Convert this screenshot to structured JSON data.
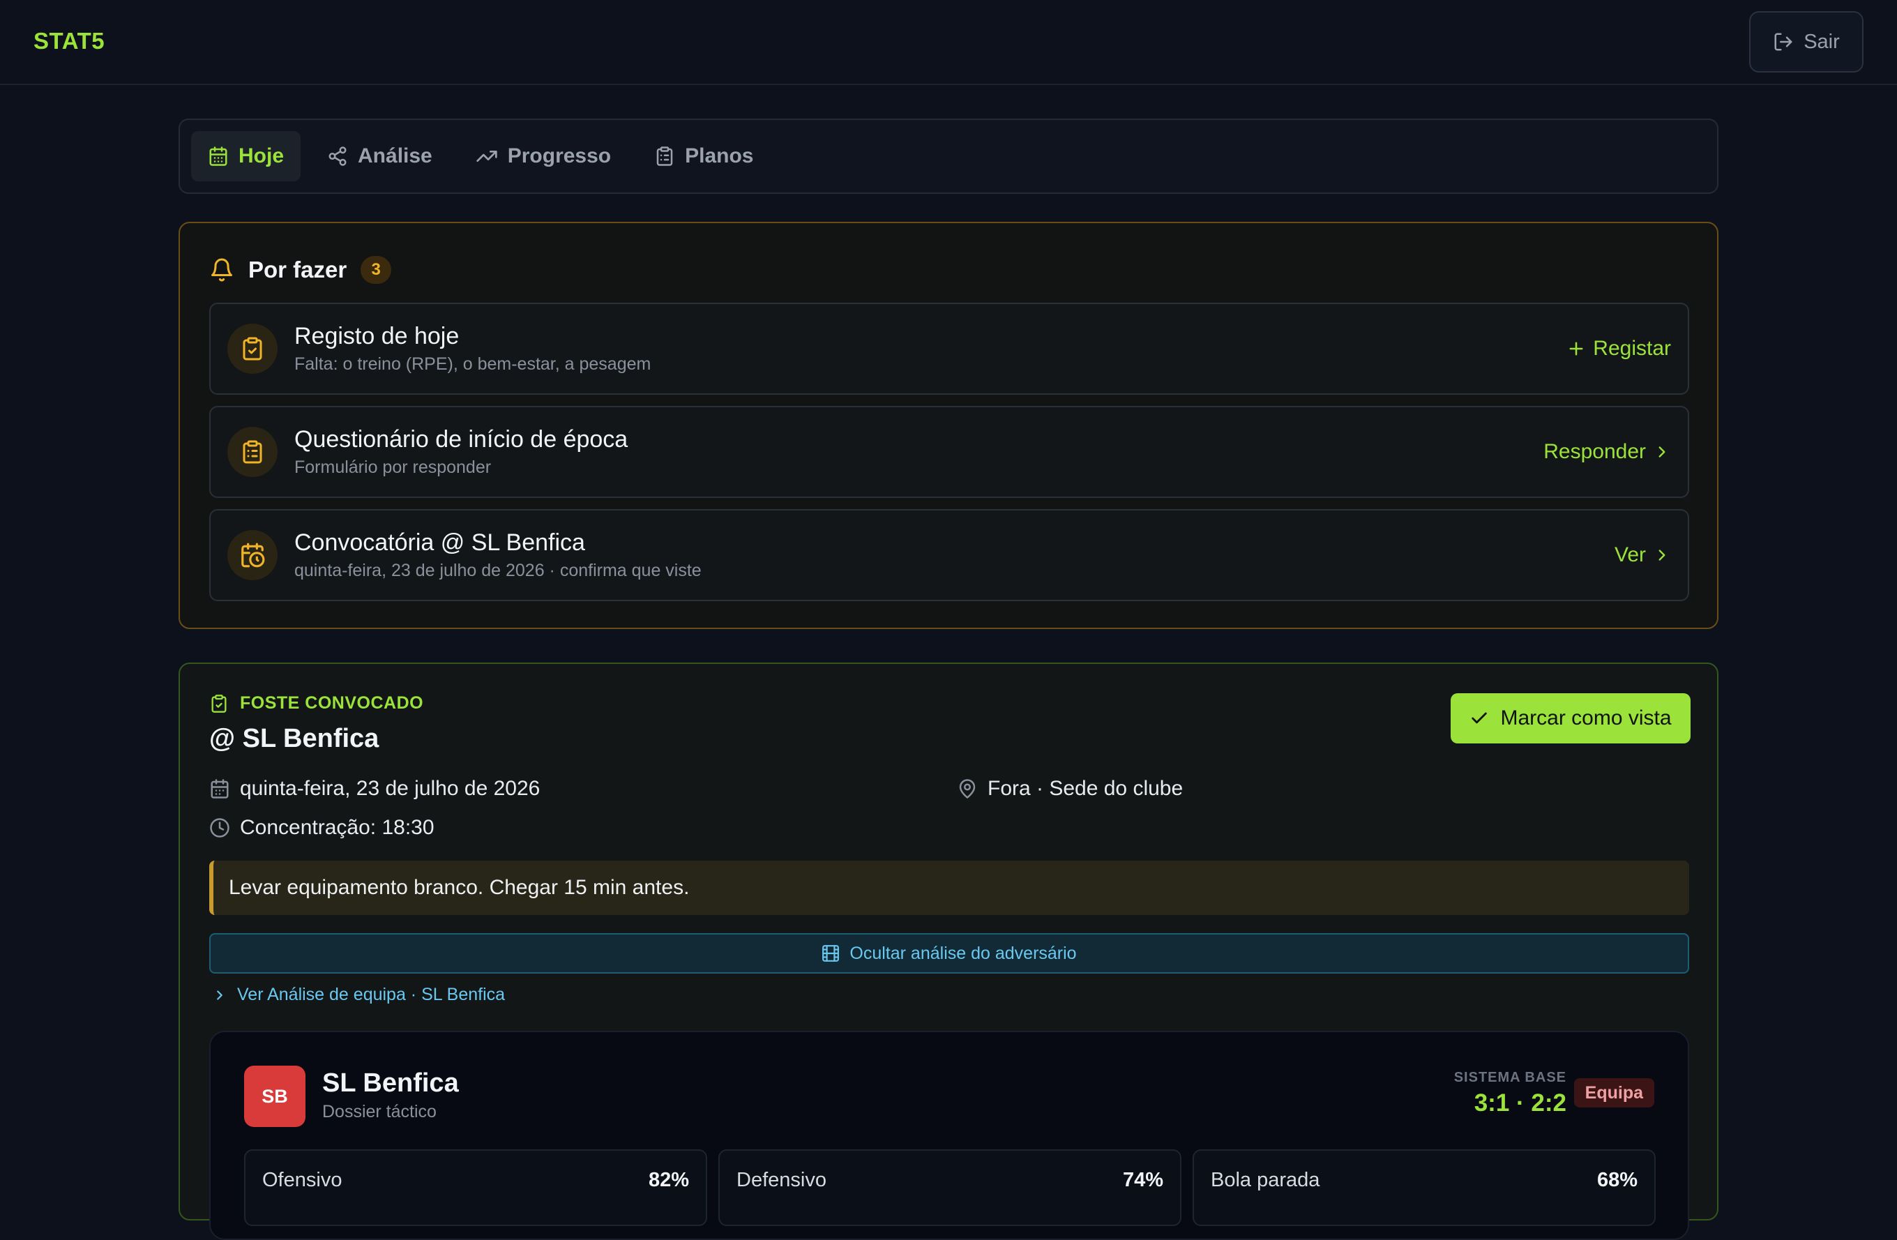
{
  "brand": "STAT5",
  "header": {
    "logout_label": "Sair"
  },
  "tabs": [
    {
      "label": "Hoje",
      "icon": "calendar-icon",
      "active": true
    },
    {
      "label": "Análise",
      "icon": "share-icon",
      "active": false
    },
    {
      "label": "Progresso",
      "icon": "trending-up-icon",
      "active": false
    },
    {
      "label": "Planos",
      "icon": "clipboard-icon",
      "active": false
    }
  ],
  "todo": {
    "title": "Por fazer",
    "count": "3",
    "items": [
      {
        "title": "Registo de hoje",
        "subtitle": "Falta: o treino (RPE), o bem-estar, a pesagem",
        "action": "Registar",
        "icon": "clipboard-check-icon"
      },
      {
        "title": "Questionário de início de época",
        "subtitle": "Formulário por responder",
        "action": "Responder",
        "icon": "clipboard-list-icon"
      },
      {
        "title": "Convocatória @ SL Benfica",
        "subtitle": "quinta-feira, 23 de julho de 2026 · confirma que viste",
        "action": "Ver",
        "icon": "calendar-clock-icon"
      }
    ]
  },
  "call": {
    "tag": "FOSTE CONVOCADO",
    "title": "@ SL Benfica",
    "mark_label": "Marcar como vista",
    "date": "quinta-feira, 23 de julho de 2026",
    "location": "Fora · Sede do clube",
    "meeting": "Concentração: 18:30",
    "note": "Levar equipamento branco. Chegar 15 min antes.",
    "toggle_label": "Ocultar análise do adversário",
    "link_label": "Ver Análise de equipa · SL Benfica"
  },
  "dossier": {
    "badge": "SB",
    "team": "SL Benfica",
    "subtitle": "Dossier táctico",
    "system_label": "SISTEMA BASE",
    "system_value": "3:1 · 2:2",
    "tag": "Equipa",
    "metrics": [
      {
        "label": "Ofensivo",
        "value": "82%"
      },
      {
        "label": "Defensivo",
        "value": "74%"
      },
      {
        "label": "Bola parada",
        "value": "68%"
      }
    ]
  },
  "colors": {
    "accent": "#9be23b",
    "warning": "#f0b429",
    "info": "#6ac8f0",
    "danger": "#d93a3a"
  }
}
